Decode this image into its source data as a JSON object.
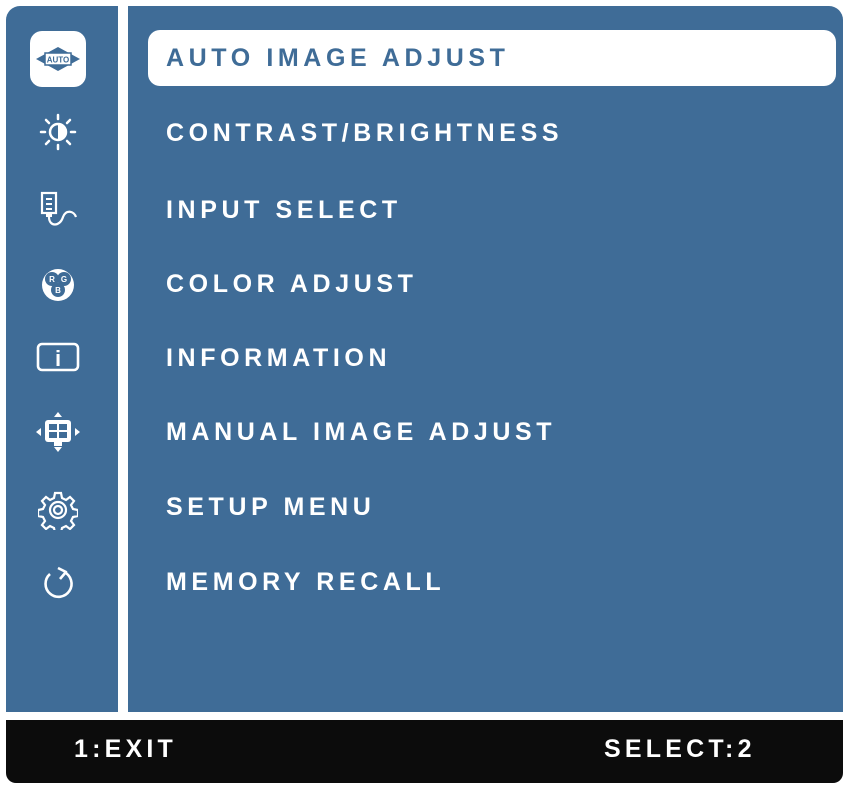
{
  "menu": {
    "items": [
      {
        "label": "AUTO IMAGE ADJUST",
        "icon": "auto-icon",
        "icon_text": "AUTO",
        "selected": true
      },
      {
        "label": "CONTRAST/BRIGHTNESS",
        "icon": "brightness-icon",
        "selected": false
      },
      {
        "label": "INPUT SELECT",
        "icon": "input-connector-icon",
        "selected": false
      },
      {
        "label": "COLOR ADJUST",
        "icon": "rgb-color-icon",
        "icon_text": [
          "R",
          "G",
          "B"
        ],
        "selected": false
      },
      {
        "label": "INFORMATION",
        "icon": "info-icon",
        "icon_text": "i",
        "selected": false
      },
      {
        "label": "MANUAL IMAGE ADJUST",
        "icon": "manual-image-adjust-icon",
        "selected": false
      },
      {
        "label": "SETUP MENU",
        "icon": "gear-icon",
        "selected": false
      },
      {
        "label": "MEMORY RECALL",
        "icon": "recall-icon",
        "selected": false
      }
    ]
  },
  "footer": {
    "exit_label": "1:EXIT",
    "select_label": "SELECT:2"
  },
  "colors": {
    "panel": "#3f6c97",
    "highlight": "#ffffff",
    "footer": "#0c0c0c",
    "text": "#ffffff",
    "selected_text": "#3f6c97"
  }
}
